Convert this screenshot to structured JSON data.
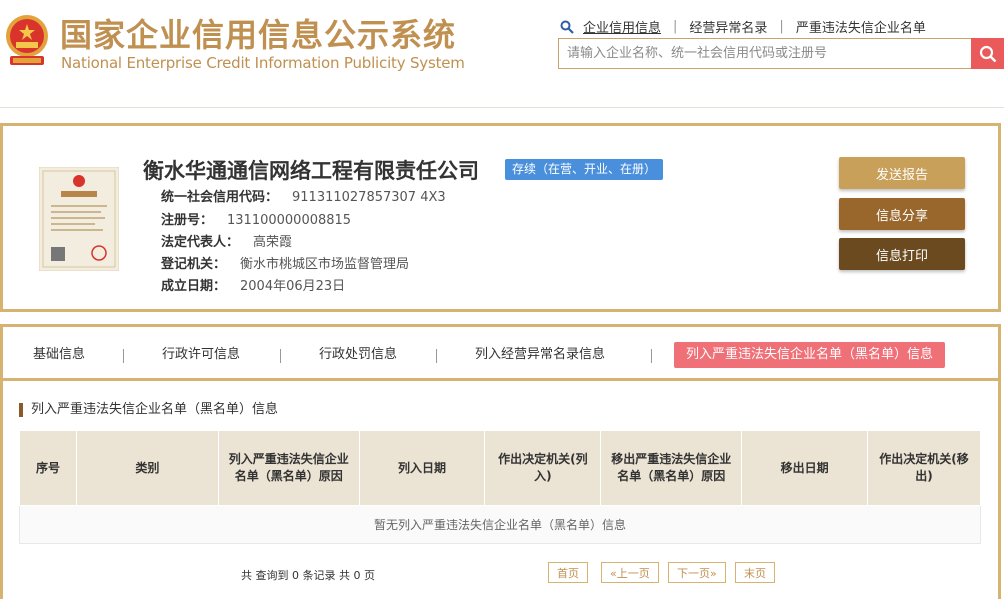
{
  "header": {
    "title_cn": "国家企业信用信息公示系统",
    "title_en": "National Enterprise Credit Information Publicity System",
    "links": [
      "企业信用信息",
      "经营异常名录",
      "严重违法失信企业名单"
    ],
    "link_sep": "|",
    "search_placeholder": "请输入企业名称、统一社会信用代码或注册号"
  },
  "company": {
    "name": "衡水华通通信网络工程有限责任公司",
    "status": "存续（在营、开业、在册）",
    "fields": [
      {
        "label": "统一社会信用代码：",
        "value": "911311027857307 4X3"
      },
      {
        "label": "注册号：",
        "value": "131100000008815"
      },
      {
        "label": "法定代表人：",
        "value": "高荣霞"
      },
      {
        "label": "登记机关：",
        "value": "衡水市桃城区市场监督管理局"
      },
      {
        "label": "成立日期：",
        "value": "2004年06月23日"
      }
    ],
    "buttons": {
      "send": "发送报告",
      "share": "信息分享",
      "print": "信息打印"
    }
  },
  "tabs": [
    "基础信息",
    "行政许可信息",
    "行政处罚信息",
    "列入经营异常名录信息",
    "列入严重违法失信企业名单（黑名单）信息"
  ],
  "section": {
    "title": "列入严重违法失信企业名单（黑名单）信息",
    "columns": [
      "序号",
      "类别",
      "列入严重违法失信企业名单（黑名单）原因",
      "列入日期",
      "作出决定机关(列入)",
      "移出严重违法失信企业名单（黑名单）原因",
      "移出日期",
      "作出决定机关(移出)"
    ],
    "empty_text": "暂无列入严重违法失信企业名单（黑名单）信息"
  },
  "pagination": {
    "summary": "共 查询到 0 条记录 共 0 页",
    "first": "首页",
    "prev": "«上一页",
    "next": "下一页»",
    "last": "末页"
  },
  "colors": {
    "gold": "#c09050",
    "border": "#d6b370",
    "active_tab": "#f07078",
    "status": "#4a8fdc",
    "search_btn": "#ea5a5a"
  }
}
